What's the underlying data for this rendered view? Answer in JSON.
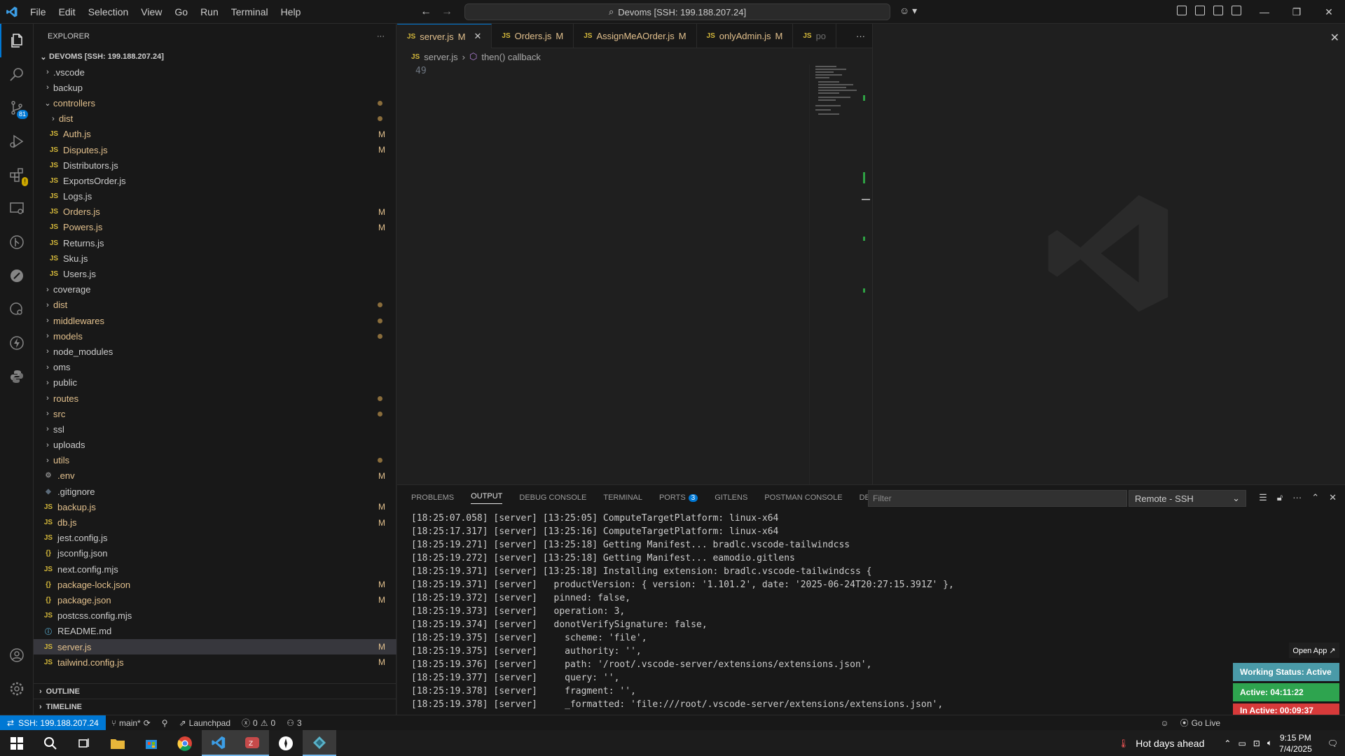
{
  "titlebar": {
    "menu": [
      "File",
      "Edit",
      "Selection",
      "View",
      "Go",
      "Run",
      "Terminal",
      "Help"
    ],
    "search": "Devoms [SSH: 199.188.207.24]"
  },
  "activitybar": {
    "scm_badge": "81"
  },
  "explorer": {
    "title": "EXPLORER",
    "root": "DEVOMS [SSH: 199.188.207.24]",
    "items": [
      {
        "name": ".vscode",
        "type": "folder",
        "depth": 1,
        "expanded": false,
        "status": ""
      },
      {
        "name": "backup",
        "type": "folder",
        "depth": 1,
        "expanded": false,
        "status": ""
      },
      {
        "name": "controllers",
        "type": "folder",
        "depth": 1,
        "expanded": true,
        "status": "dot"
      },
      {
        "name": "dist",
        "type": "folder",
        "depth": 2,
        "expanded": false,
        "status": "dot"
      },
      {
        "name": "Auth.js",
        "type": "js",
        "depth": 2,
        "status": "M"
      },
      {
        "name": "Disputes.js",
        "type": "js",
        "depth": 2,
        "status": "M"
      },
      {
        "name": "Distributors.js",
        "type": "js",
        "depth": 2,
        "status": ""
      },
      {
        "name": "ExportsOrder.js",
        "type": "js",
        "depth": 2,
        "status": ""
      },
      {
        "name": "Logs.js",
        "type": "js",
        "depth": 2,
        "status": ""
      },
      {
        "name": "Orders.js",
        "type": "js",
        "depth": 2,
        "status": "M"
      },
      {
        "name": "Powers.js",
        "type": "js",
        "depth": 2,
        "status": "M"
      },
      {
        "name": "Returns.js",
        "type": "js",
        "depth": 2,
        "status": ""
      },
      {
        "name": "Sku.js",
        "type": "js",
        "depth": 2,
        "status": ""
      },
      {
        "name": "Users.js",
        "type": "js",
        "depth": 2,
        "status": ""
      },
      {
        "name": "coverage",
        "type": "folder",
        "depth": 1,
        "expanded": false,
        "status": ""
      },
      {
        "name": "dist",
        "type": "folder",
        "depth": 1,
        "expanded": false,
        "status": "dot"
      },
      {
        "name": "middlewares",
        "type": "folder",
        "depth": 1,
        "expanded": false,
        "status": "dot"
      },
      {
        "name": "models",
        "type": "folder",
        "depth": 1,
        "expanded": false,
        "status": "dot"
      },
      {
        "name": "node_modules",
        "type": "folder",
        "depth": 1,
        "expanded": false,
        "status": ""
      },
      {
        "name": "oms",
        "type": "folder",
        "depth": 1,
        "expanded": false,
        "status": ""
      },
      {
        "name": "public",
        "type": "folder",
        "depth": 1,
        "expanded": false,
        "status": ""
      },
      {
        "name": "routes",
        "type": "folder",
        "depth": 1,
        "expanded": false,
        "status": "dot"
      },
      {
        "name": "src",
        "type": "folder",
        "depth": 1,
        "expanded": false,
        "status": "dot"
      },
      {
        "name": "ssl",
        "type": "folder",
        "depth": 1,
        "expanded": false,
        "status": ""
      },
      {
        "name": "uploads",
        "type": "folder",
        "depth": 1,
        "expanded": false,
        "status": ""
      },
      {
        "name": "utils",
        "type": "folder",
        "depth": 1,
        "expanded": false,
        "status": "dot"
      },
      {
        "name": ".env",
        "type": "gear",
        "depth": 1,
        "status": "M"
      },
      {
        "name": ".gitignore",
        "type": "git",
        "depth": 1,
        "status": ""
      },
      {
        "name": "backup.js",
        "type": "js",
        "depth": 1,
        "status": "M"
      },
      {
        "name": "db.js",
        "type": "js",
        "depth": 1,
        "status": "M"
      },
      {
        "name": "jest.config.js",
        "type": "js",
        "depth": 1,
        "status": ""
      },
      {
        "name": "jsconfig.json",
        "type": "json",
        "depth": 1,
        "status": ""
      },
      {
        "name": "next.config.mjs",
        "type": "js",
        "depth": 1,
        "status": ""
      },
      {
        "name": "package-lock.json",
        "type": "json",
        "depth": 1,
        "status": "M"
      },
      {
        "name": "package.json",
        "type": "json",
        "depth": 1,
        "status": "M"
      },
      {
        "name": "postcss.config.mjs",
        "type": "js",
        "depth": 1,
        "status": ""
      },
      {
        "name": "README.md",
        "type": "info",
        "depth": 1,
        "status": ""
      },
      {
        "name": "server.js",
        "type": "js",
        "depth": 1,
        "status": "M",
        "selected": true
      },
      {
        "name": "tailwind.config.js",
        "type": "js",
        "depth": 1,
        "status": "M"
      }
    ],
    "outline": "OUTLINE",
    "timeline": "TIMELINE"
  },
  "tabs": [
    {
      "label": "server.js",
      "status": "M",
      "active": true
    },
    {
      "label": "Orders.js",
      "status": "M",
      "active": false
    },
    {
      "label": "AssignMeAOrder.js",
      "status": "M",
      "active": false
    },
    {
      "label": "onlyAdmin.js",
      "status": "M",
      "active": false
    },
    {
      "label": "po",
      "status": "",
      "active": false
    }
  ],
  "breadcrumb": {
    "file": "server.js",
    "symbol": "then() callback"
  },
  "editor": {
    "line_number": "49"
  },
  "panel": {
    "tabs": [
      "PROBLEMS",
      "OUTPUT",
      "DEBUG CONSOLE",
      "TERMINAL",
      "PORTS",
      "GITLENS",
      "POSTMAN CONSOLE",
      "DEVDB"
    ],
    "ports_badge": "3",
    "filter_placeholder": "Filter",
    "channel": "Remote - SSH",
    "lines": [
      "[18:25:07.058] [server] [13:25:05] ComputeTargetPlatform: linux-x64",
      "[18:25:17.317] [server] [13:25:16] ComputeTargetPlatform: linux-x64",
      "[18:25:19.271] [server] [13:25:18] Getting Manifest... bradlc.vscode-tailwindcss",
      "[18:25:19.272] [server] [13:25:18] Getting Manifest... eamodio.gitlens",
      "[18:25:19.371] [server] [13:25:18] Installing extension: bradlc.vscode-tailwindcss {",
      "[18:25:19.371] [server]   productVersion: { version: '1.101.2', date: '2025-06-24T20:27:15.391Z' },",
      "[18:25:19.372] [server]   pinned: false,",
      "[18:25:19.373] [server]   operation: 3,",
      "[18:25:19.374] [server]   donotVerifySignature: false,",
      "[18:25:19.375] [server]     scheme: 'file',",
      "[18:25:19.375] [server]     authority: '',",
      "[18:25:19.376] [server]     path: '/root/.vscode-server/extensions/extensions.json',",
      "[18:25:19.377] [server]     query: '',",
      "[18:25:19.378] [server]     fragment: '',",
      "[18:25:19.378] [server]     _formatted: 'file:///root/.vscode-server/extensions/extensions.json',"
    ]
  },
  "widget": {
    "open_app": "Open App ↗",
    "status": "Working Status: Active",
    "active": "Active: 04:11:22",
    "inactive": "In Active: 00:09:37",
    "colors": {
      "status": "#4a9aa8",
      "active": "#2ea44f",
      "inactive": "#d73a3a"
    }
  },
  "statusbar": {
    "remote": "SSH: 199.188.207.24",
    "branch": "main*",
    "launchpad": "Launchpad",
    "errors": "0",
    "warnings": "0",
    "ports": "3",
    "golive": "Go Live"
  },
  "taskbar": {
    "weather": "Hot days ahead",
    "time": "9:15 PM",
    "date": "7/4/2025"
  }
}
